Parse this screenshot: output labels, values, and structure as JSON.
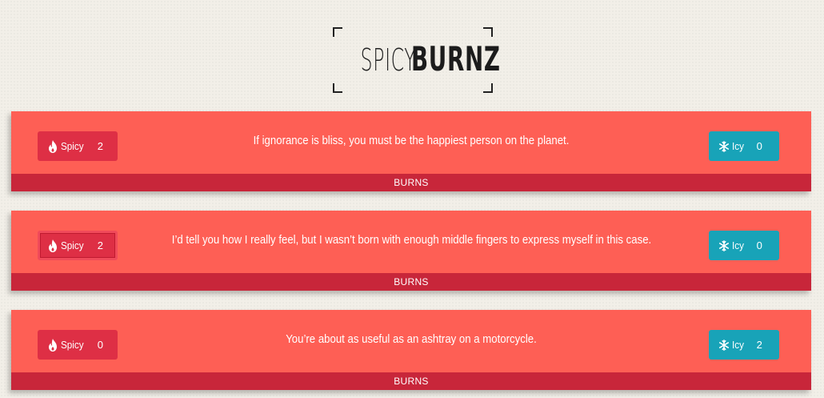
{
  "logo": {
    "light": "SPICY",
    "bold": "BURNZ"
  },
  "burns": [
    {
      "quote": "If ignorance is bliss, you must be the happiest person on the planet.",
      "spicy_label": "Spicy",
      "spicy_count": "2",
      "icy_label": "Icy",
      "icy_count": "0",
      "footer": "BURNS"
    },
    {
      "quote": "I’d tell you how I really feel, but I wasn’t born with enough middle fingers to express myself in this case.",
      "spicy_label": "Spicy",
      "spicy_count": "2",
      "icy_label": "Icy",
      "icy_count": "0",
      "footer": "BURNS"
    },
    {
      "quote": "You’re about as useful as an ashtray on a motorcycle.",
      "spicy_label": "Spicy",
      "spicy_count": "0",
      "icy_label": "Icy",
      "icy_count": "2",
      "footer": "BURNS"
    }
  ],
  "icons": {
    "spicy": "flame-icon",
    "icy": "snowflake-icon"
  },
  "colors": {
    "background": "#f2efe8",
    "card": "#fe5f55",
    "footer": "#c8263a",
    "spicy_button": "#de2f45",
    "icy_button": "#18a3b8"
  }
}
